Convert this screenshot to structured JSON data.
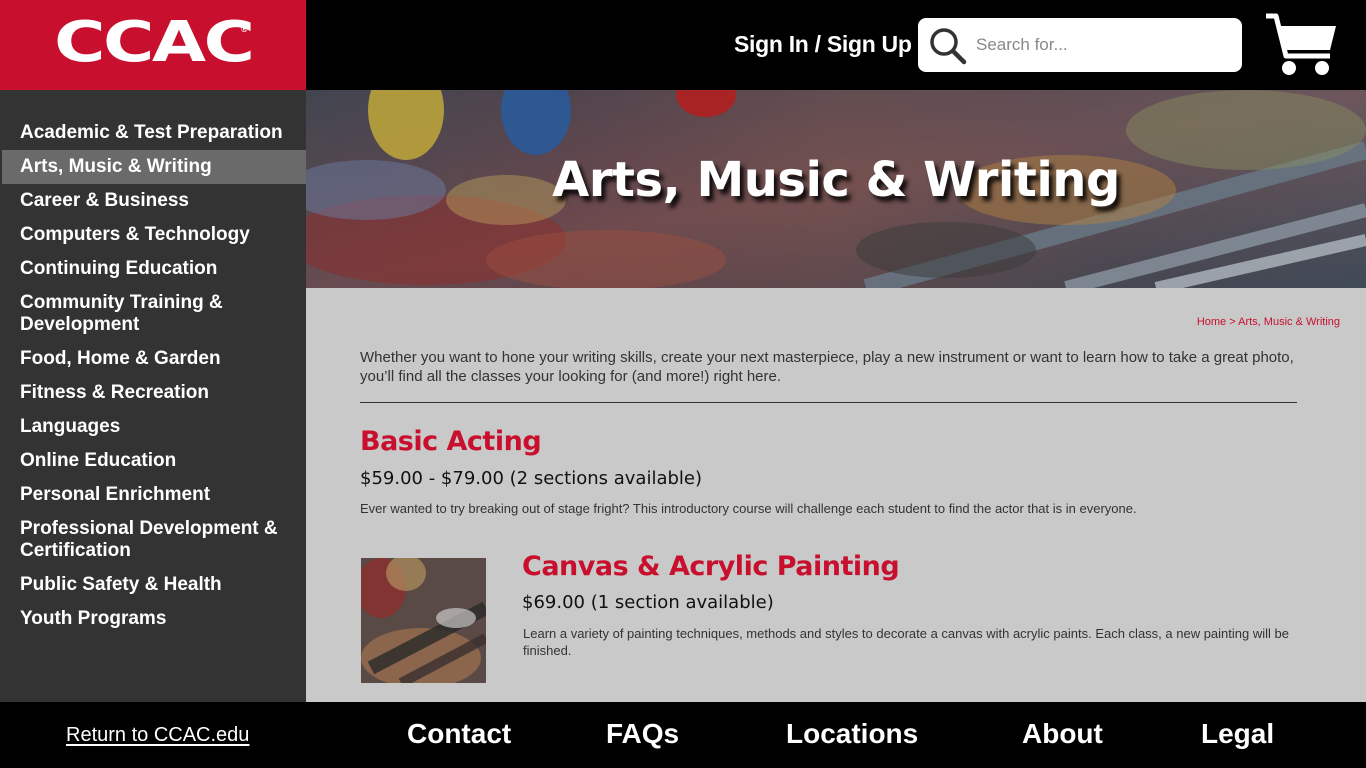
{
  "logo": {
    "text": "CCAC",
    "reg": "®"
  },
  "header": {
    "signin_label": "Sign In / Sign Up",
    "search_placeholder": "Search for..."
  },
  "sidebar": {
    "items": [
      {
        "label": "Academic & Test Preparation",
        "active": false
      },
      {
        "label": "Arts, Music & Writing",
        "active": true
      },
      {
        "label": "Career & Business",
        "active": false
      },
      {
        "label": "Computers & Technology",
        "active": false
      },
      {
        "label": "Continuing Education",
        "active": false
      },
      {
        "label": "Community Training & Development",
        "active": false
      },
      {
        "label": "Food, Home & Garden",
        "active": false
      },
      {
        "label": "Fitness & Recreation",
        "active": false
      },
      {
        "label": "Languages",
        "active": false
      },
      {
        "label": "Online Education",
        "active": false
      },
      {
        "label": "Personal Enrichment",
        "active": false
      },
      {
        "label": "Professional Development & Certification",
        "active": false
      },
      {
        "label": "Public Safety & Health",
        "active": false
      },
      {
        "label": "Youth Programs",
        "active": false
      }
    ]
  },
  "hero": {
    "title": "Arts, Music & Writing"
  },
  "breadcrumb": {
    "home": "Home",
    "separator": ">",
    "current": "Arts, Music & Writing"
  },
  "intro": "Whether you want to hone your writing skills, create your next masterpiece, play a new instrument or want to learn how to take a great photo, you’ll find all the classes your looking for (and more!) right here.",
  "courses": [
    {
      "title": "Basic Acting",
      "price": "$59.00 - $79.00 (2 sections available)",
      "description": "Ever wanted to try breaking out of stage fright? This introductory course will challenge each student to find the actor that is in everyone."
    },
    {
      "title": "Canvas & Acrylic Painting",
      "price": "$69.00 (1 section available)",
      "description": "Learn a variety of painting techniques, methods and styles to decorate a canvas with acrylic paints. Each class, a new painting will be finished."
    }
  ],
  "footer": {
    "return_label": "Return to CCAC.edu",
    "links": [
      "Contact",
      "FAQs",
      "Locations",
      "About",
      "Legal"
    ]
  },
  "colors": {
    "brand_red": "#c8102e",
    "sidebar_bg": "#333333",
    "active_bg": "#6a6a6a",
    "content_bg": "#c9c9c9"
  }
}
